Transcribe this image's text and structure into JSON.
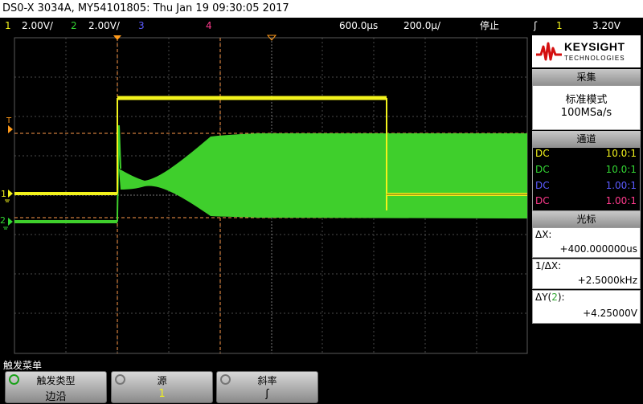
{
  "title": "DS0-X 3034A, MY54101805: Thu Jan 19 09:30:05 2017",
  "status": {
    "ch1_label": "1",
    "ch1_scale": "2.00V/",
    "ch2_label": "2",
    "ch2_scale": "2.00V/",
    "ch3_label": "3",
    "ch4_label": "4",
    "delay": "600.0µs",
    "timebase": "200.0µ/",
    "run_state": "停止",
    "trigger_symbol": "ʃ",
    "trigger_channel": "1",
    "trigger_level": "3.20V"
  },
  "colors": {
    "ch1": "#f2f21c",
    "ch2": "#33d633",
    "ch3": "#5b5bff",
    "ch4": "#ff3a8c",
    "grid": "#4a4a4a",
    "cursor": "#ff9a4a",
    "trigger": "#ff9a1a"
  },
  "brand": {
    "name": "KEYSIGHT",
    "sub": "TECHNOLOGIES"
  },
  "acquire": {
    "header": "采集",
    "mode": "标准模式",
    "rate": "100MSa/s"
  },
  "channels": {
    "header": "通道",
    "rows": [
      {
        "coupling": "DC",
        "probe": "10.0:1"
      },
      {
        "coupling": "DC",
        "probe": "10.0:1"
      },
      {
        "coupling": "DC",
        "probe": "1.00:1"
      },
      {
        "coupling": "DC",
        "probe": "1.00:1"
      }
    ]
  },
  "cursors": {
    "header": "光标",
    "dx_label": "ΔX:",
    "dx_value": "+400.000000us",
    "inv_label": "1/ΔX:",
    "inv_value": "+2.5000kHz",
    "dy_label_pre": "ΔY(",
    "dy_label_ch": "2",
    "dy_label_post": "):",
    "dy_value": "+4.25000V"
  },
  "markers": {
    "trigger": "T",
    "ch1": "1",
    "ch2": "2"
  },
  "menu": {
    "title": "触发菜单",
    "keys": [
      {
        "label": "触发类型",
        "value": "边沿"
      },
      {
        "label": "源",
        "value": "1"
      },
      {
        "label": "斜率",
        "value": "ʃ"
      }
    ]
  }
}
